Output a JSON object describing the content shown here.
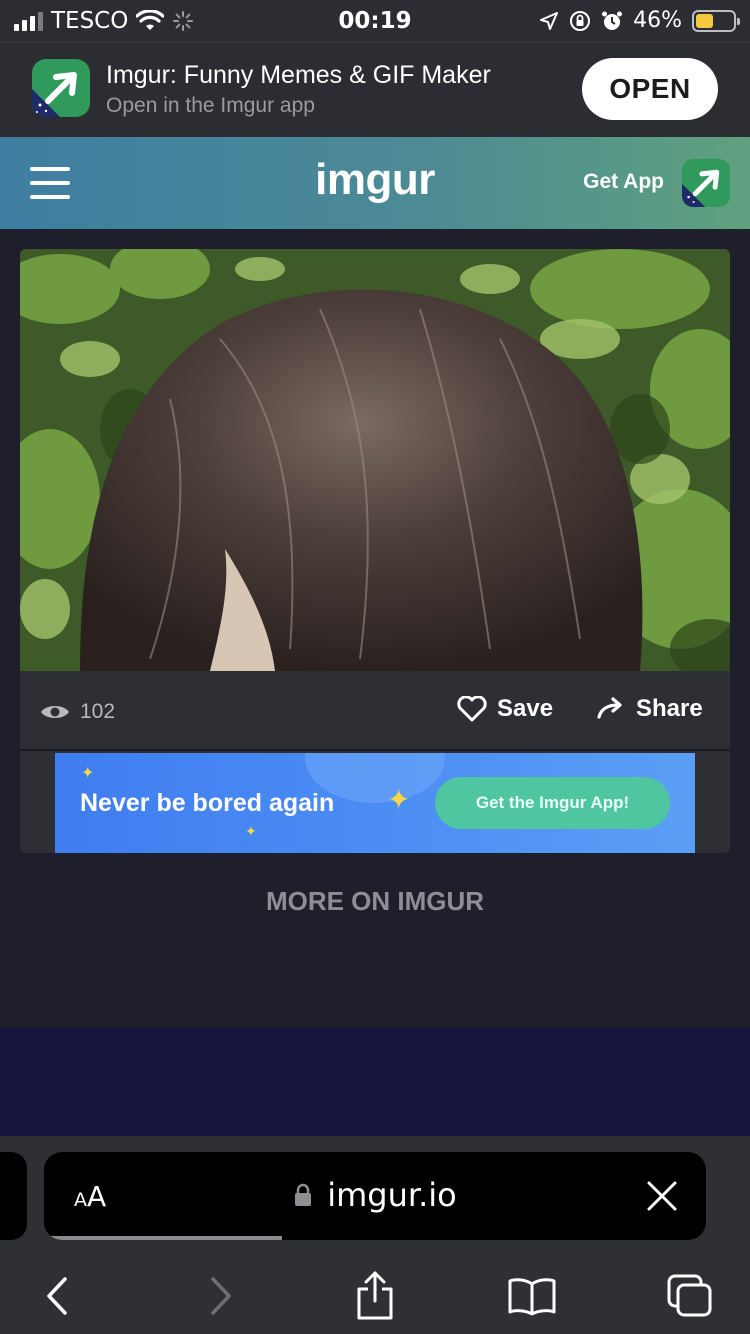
{
  "status_bar": {
    "carrier": "TESCO",
    "time": "00:19",
    "battery": "46%",
    "battery_level": 0.46
  },
  "app_banner": {
    "title": "Imgur: Funny Memes & GIF Maker",
    "subtitle": "Open in the Imgur app",
    "open_label": "OPEN"
  },
  "header": {
    "logo": "imgur",
    "get_app_label": "Get App"
  },
  "post": {
    "views": "102",
    "save_label": "Save",
    "share_label": "Share"
  },
  "promo": {
    "text": "Never be bored again",
    "button_label": "Get the Imgur App!"
  },
  "more_label": "MORE ON IMGUR",
  "safari": {
    "aa_small": "A",
    "aa_large": "A",
    "url": "imgur.io",
    "page_load_progress": 0.36
  },
  "colors": {
    "accent_green": "#4fc6a0",
    "header_start": "#3f7ea2",
    "header_end": "#5fa17e",
    "promo_blue": "#4d8ef4"
  },
  "icons": [
    "signal-icon",
    "wifi-icon",
    "loading-icon",
    "location-icon",
    "orientation-lock-icon",
    "alarm-icon",
    "battery-icon",
    "imgur-app-icon",
    "menu-icon",
    "eye-icon",
    "heart-icon",
    "share-arrow-icon",
    "lock-icon",
    "close-icon",
    "back-icon",
    "forward-icon",
    "share-icon",
    "bookmarks-icon",
    "tabs-icon"
  ]
}
